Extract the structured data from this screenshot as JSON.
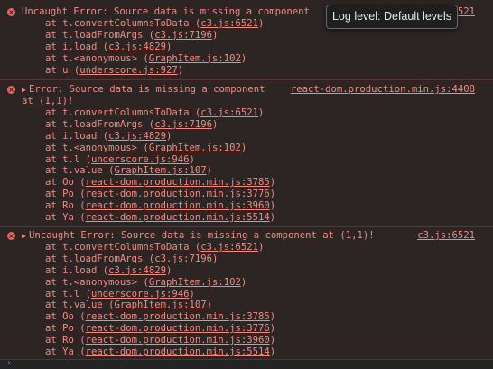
{
  "tooltip": {
    "text": "Log level: Default levels"
  },
  "entries": [
    {
      "message": "Uncaught Error: Source data is missing a component",
      "source": "c3.js:6521",
      "source_visible": "521",
      "frames": [
        {
          "prefix": "at t.convertColumnsToData (",
          "link": "c3.js:6521",
          "suffix": ")"
        },
        {
          "prefix": "at t.loadFromArgs (",
          "link": "c3.js:7196",
          "suffix": ")"
        },
        {
          "prefix": "at i.load (",
          "link": "c3.js:4829",
          "suffix": ")"
        },
        {
          "prefix": "at t.<anonymous> (",
          "link": "GraphItem.js:102",
          "suffix": ")"
        },
        {
          "prefix": "at u (",
          "link": "underscore.js:927",
          "suffix": ")"
        }
      ]
    },
    {
      "message": "Error: Source data is missing a component",
      "message_cont": "at (1,1)!",
      "source": "react-dom.production.min.js:4408",
      "frames": [
        {
          "prefix": "at t.convertColumnsToData (",
          "link": "c3.js:6521",
          "suffix": ")"
        },
        {
          "prefix": "at t.loadFromArgs (",
          "link": "c3.js:7196",
          "suffix": ")"
        },
        {
          "prefix": "at i.load (",
          "link": "c3.js:4829",
          "suffix": ")"
        },
        {
          "prefix": "at t.<anonymous> (",
          "link": "GraphItem.js:102",
          "suffix": ")"
        },
        {
          "prefix": "at t.l (",
          "link": "underscore.js:946",
          "suffix": ")"
        },
        {
          "prefix": "at t.value (",
          "link": "GraphItem.js:107",
          "suffix": ")"
        },
        {
          "prefix": "at Oo (",
          "link": "react-dom.production.min.js:3785",
          "suffix": ")"
        },
        {
          "prefix": "at Po (",
          "link": "react-dom.production.min.js:3776",
          "suffix": ")"
        },
        {
          "prefix": "at Ro (",
          "link": "react-dom.production.min.js:3960",
          "suffix": ")"
        },
        {
          "prefix": "at Ya (",
          "link": "react-dom.production.min.js:5514",
          "suffix": ")"
        }
      ]
    },
    {
      "message": "Uncaught Error: Source data is missing a component at (1,1)!",
      "source": "c3.js:6521",
      "frames": [
        {
          "prefix": "at t.convertColumnsToData (",
          "link": "c3.js:6521",
          "suffix": ")"
        },
        {
          "prefix": "at t.loadFromArgs (",
          "link": "c3.js:7196",
          "suffix": ")"
        },
        {
          "prefix": "at i.load (",
          "link": "c3.js:4829",
          "suffix": ")"
        },
        {
          "prefix": "at t.<anonymous> (",
          "link": "GraphItem.js:102",
          "suffix": ")"
        },
        {
          "prefix": "at t.l (",
          "link": "underscore.js:946",
          "suffix": ")"
        },
        {
          "prefix": "at t.value (",
          "link": "GraphItem.js:107",
          "suffix": ")"
        },
        {
          "prefix": "at Oo (",
          "link": "react-dom.production.min.js:3785",
          "suffix": ")"
        },
        {
          "prefix": "at Po (",
          "link": "react-dom.production.min.js:3776",
          "suffix": ")"
        },
        {
          "prefix": "at Ro (",
          "link": "react-dom.production.min.js:3960",
          "suffix": ")"
        },
        {
          "prefix": "at Ya (",
          "link": "react-dom.production.min.js:5514",
          "suffix": ")"
        }
      ]
    }
  ],
  "colors": {
    "error_text": "#f28b82",
    "error_bg": "#2d2424",
    "separator": "#5a3434",
    "prompt_caret": "#4d90fe"
  },
  "icons": {
    "error": "error-icon",
    "expand": "expand-triangle-icon",
    "prompt": "prompt-caret-icon"
  },
  "glyphs": {
    "error_x": "×",
    "triangle": "▶",
    "caret": "›"
  }
}
